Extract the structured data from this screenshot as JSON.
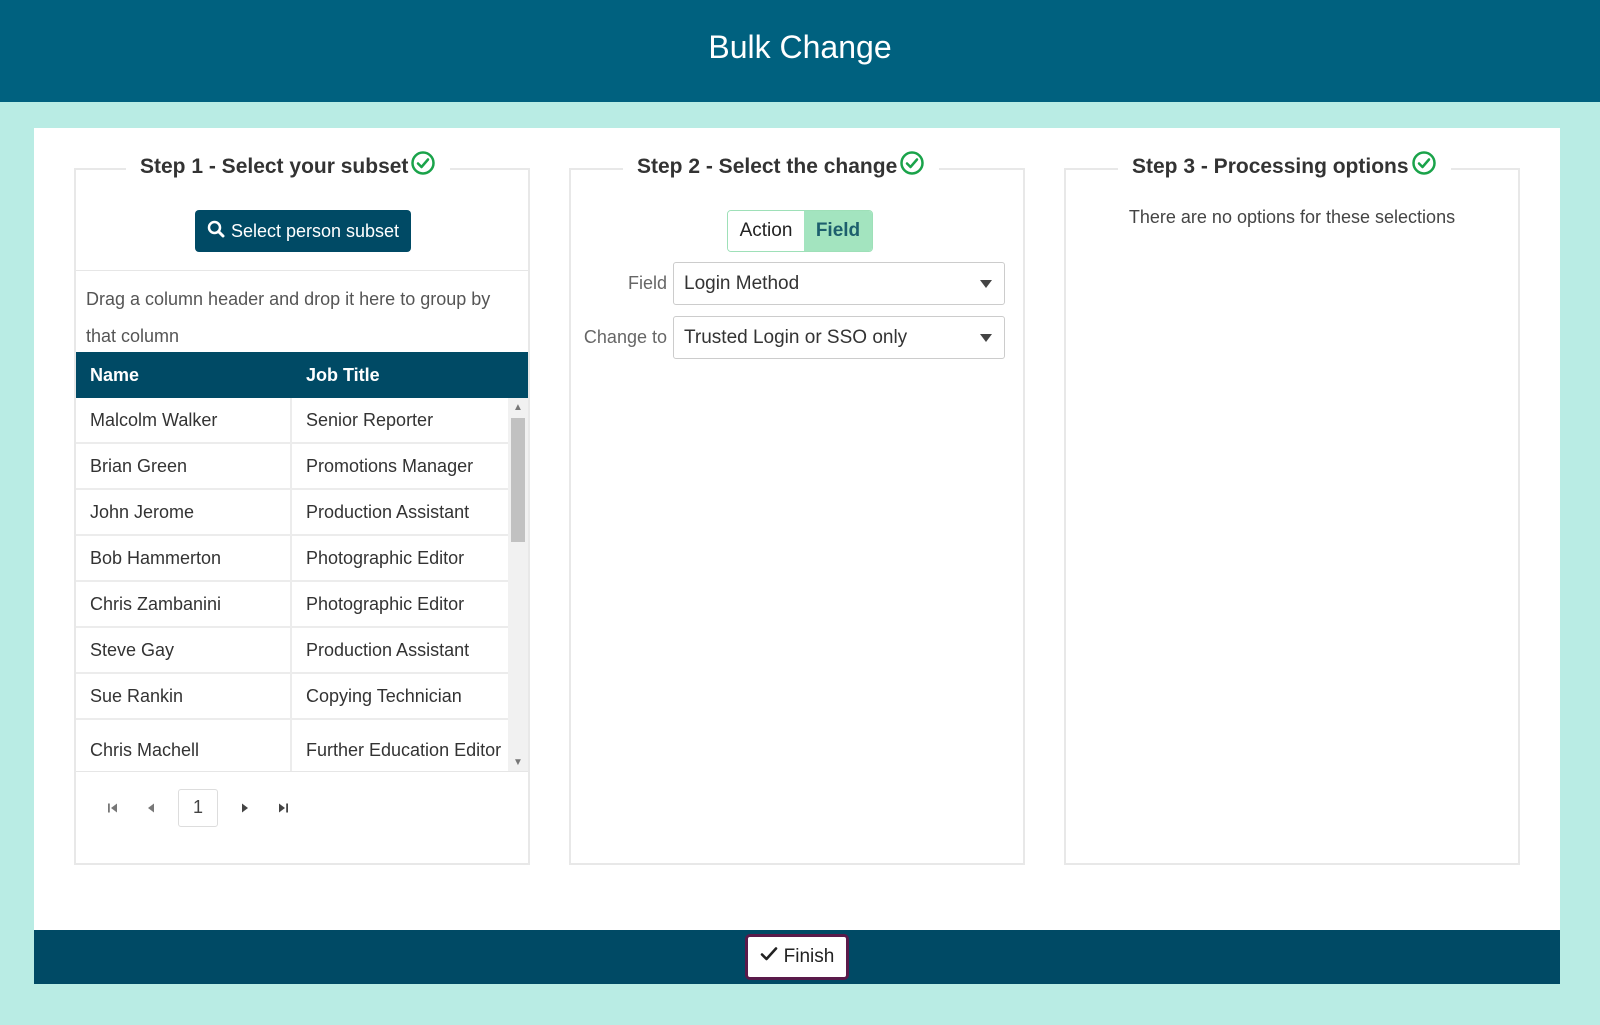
{
  "header": {
    "title": "Bulk Change"
  },
  "step1": {
    "legend": "Step 1 - Select your subset",
    "subset_button": "Select person subset",
    "group_hint": "Drag a column header and drop it here to group by that column",
    "columns": [
      "Name",
      "Job Title"
    ],
    "rows": [
      {
        "name": "Malcolm Walker",
        "job": "Senior Reporter"
      },
      {
        "name": "Brian Green",
        "job": "Promotions Manager"
      },
      {
        "name": "John Jerome",
        "job": "Production Assistant"
      },
      {
        "name": "Bob Hammerton",
        "job": "Photographic Editor"
      },
      {
        "name": "Chris Zambanini",
        "job": "Photographic Editor"
      },
      {
        "name": "Steve Gay",
        "job": "Production Assistant"
      },
      {
        "name": "Sue Rankin",
        "job": "Copying Technician"
      },
      {
        "name": "Chris Machell",
        "job": "Further Education Editor"
      }
    ],
    "current_page": "1"
  },
  "step2": {
    "legend": "Step 2 - Select the change",
    "toggle": {
      "action": "Action",
      "field": "Field",
      "selected": "Field"
    },
    "field_label": "Field",
    "field_value": "Login Method",
    "change_label": "Change to",
    "change_value": "Trusted Login or SSO only"
  },
  "step3": {
    "legend": "Step 3 - Processing options",
    "message": "There are no options for these selections"
  },
  "footer": {
    "finish_label": "Finish"
  },
  "colors": {
    "header": "#00617f",
    "footer": "#004a65",
    "background": "#b9ece4",
    "check": "#1aa34a",
    "toggle_selected": "#a3e4bf"
  },
  "icons": {
    "step_complete": "check-circle-icon",
    "search": "search-icon",
    "finish": "checkmark-icon"
  }
}
